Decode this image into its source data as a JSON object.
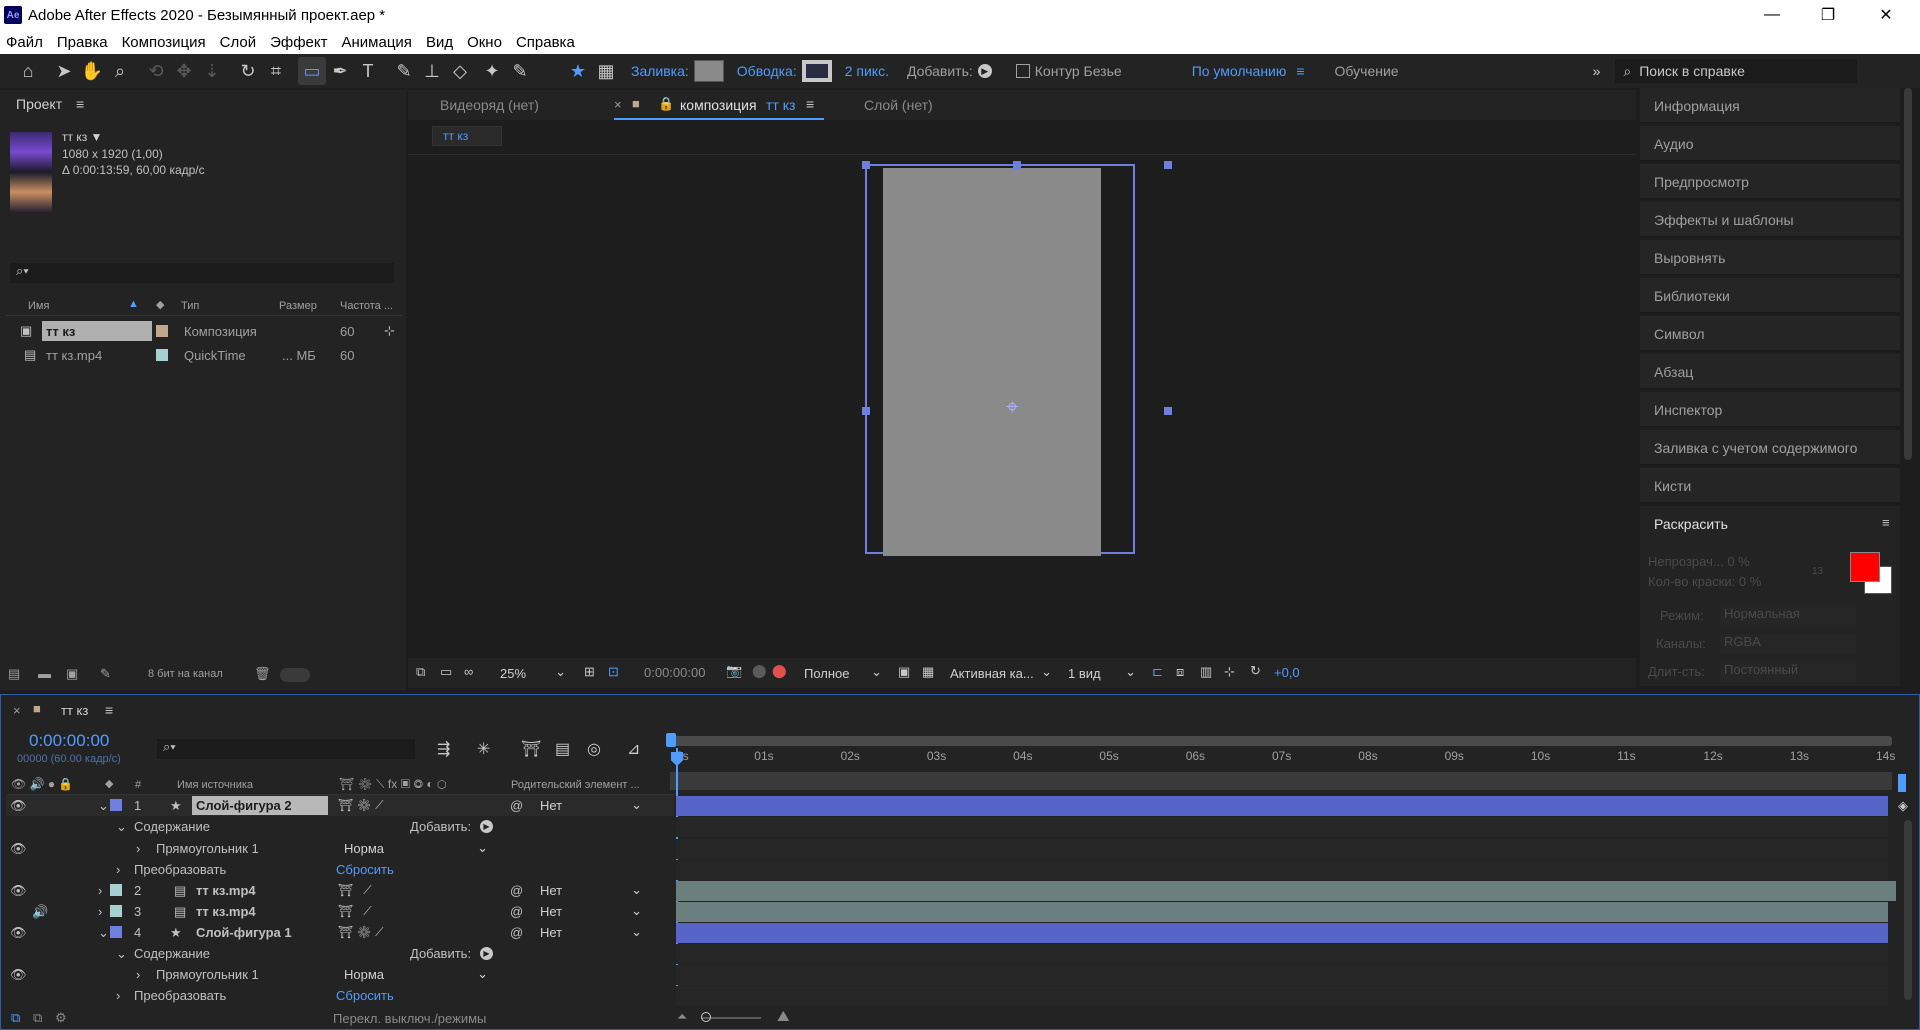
{
  "window": {
    "title": "Adobe After Effects 2020 - Безымянный проект.aep *",
    "controls": [
      "—",
      "❐",
      "✕"
    ]
  },
  "menu": [
    "Файл",
    "Правка",
    "Композиция",
    "Слой",
    "Эффект",
    "Анимация",
    "Вид",
    "Окно",
    "Справка"
  ],
  "toolbar": {
    "fill_label": "Заливка:",
    "stroke_label": "Обводка:",
    "stroke_width": "2 пикс.",
    "add_label": "Добавить:",
    "bezier_label": "Контур Безье",
    "workspace_default": "По умолчанию",
    "workspace_learn": "Обучение",
    "search_placeholder": "Поиск в справке",
    "fill_color": "#8a8a8a",
    "stroke_color": "#2b2b44"
  },
  "project": {
    "tab": "Проект",
    "comp_name": "тт кз ▼",
    "comp_size": "1080 x 1920 (1,00)",
    "comp_duration": "Δ 0:00:13:59, 60,00 кадр/с",
    "columns": [
      "Имя",
      "Тип",
      "Размер",
      "Частота ..."
    ],
    "items": [
      {
        "name": "тт кз",
        "type": "Композиция",
        "size": "",
        "rate": "60",
        "color": "#c2a88a"
      },
      {
        "name": "тт кз.mp4",
        "type": "QuickTime",
        "size": "... МБ",
        "rate": "60",
        "color": "#a8d0d0"
      }
    ],
    "bit_depth": "8 бит на канал"
  },
  "viewer": {
    "tabs": [
      "Видеоряд (нет)",
      "композиция",
      "Слой (нет)"
    ],
    "active_tab_suffix": "тт кз",
    "breadcrumb": "тт кз",
    "zoom": "25%",
    "timecode": "0:00:00:00",
    "resolution": "Полное",
    "camera": "Активная ка...",
    "views": "1 вид",
    "exposure": "+0,0",
    "canvas_color": "#8a8a8a"
  },
  "right_panels": [
    "Информация",
    "Аудио",
    "Предпросмотр",
    "Эффекты и шаблоны",
    "Выровнять",
    "Библиотеки",
    "Символ",
    "Абзац",
    "Инспектор",
    "Заливка с учетом содержимого",
    "Кисти"
  ],
  "paint": {
    "title": "Раскрасить",
    "opacity": "Непрозрач... 0 %",
    "flow": "Кол-во краски: 0 %",
    "mode_label": "Режим:",
    "mode_value": "Нормальная",
    "channels_label": "Каналы:",
    "channels_value": "RGBA",
    "duration_label": "Длит-сть:",
    "duration_value": "Постоянный",
    "brush_size": "13",
    "fg_color": "#ff0000",
    "bg_color": "#ffffff"
  },
  "timeline": {
    "tab": "тт кз",
    "timecode": "0:00:00:00",
    "frames": "00000 (60.00 кадр/с)",
    "col_source": "Имя источника",
    "col_parent": "Родительский элемент ...",
    "ruler": [
      "0s",
      "01s",
      "02s",
      "03s",
      "04s",
      "05s",
      "06s",
      "07s",
      "08s",
      "09s",
      "10s",
      "11s",
      "12s",
      "13s",
      "14s"
    ],
    "layers": [
      {
        "num": "1",
        "name": "Слой-фигура 2",
        "kind": "shape",
        "parent": "Нет",
        "color": "#6f7fe0"
      },
      {
        "num": "2",
        "name": "тт кз.mp4",
        "kind": "footage",
        "parent": "Нет",
        "color": "#a8d0d0"
      },
      {
        "num": "3",
        "name": "тт кз.mp4",
        "kind": "footage",
        "parent": "Нет",
        "color": "#a8d0d0"
      },
      {
        "num": "4",
        "name": "Слой-фигура 1",
        "kind": "shape",
        "parent": "Нет",
        "color": "#6f7fe0"
      }
    ],
    "contents_label": "Содержание",
    "add_label": "Добавить:",
    "rect_label": "Прямоугольник 1",
    "blend_mode": "Норма",
    "transform_label": "Преобразовать",
    "reset_label": "Сбросить",
    "toggle_label": "Перекл. выключ./режимы",
    "shape_bar_color": "#5865c8",
    "footage_bar_color": "#6b7f7f"
  }
}
